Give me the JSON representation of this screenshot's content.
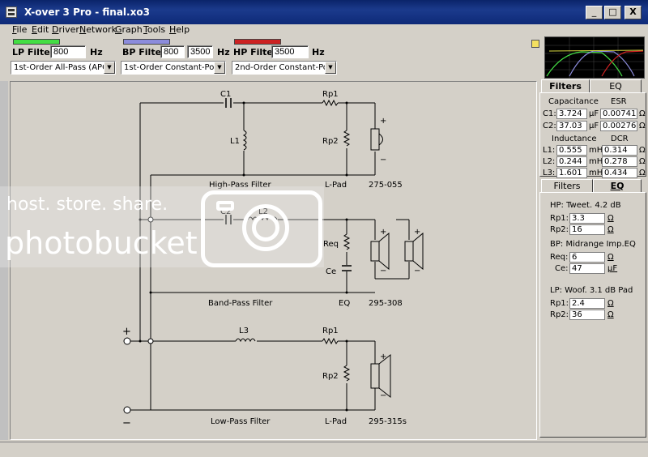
{
  "window": {
    "title": "X-over 3 Pro - final.xo3",
    "minimize": "_",
    "maximize": "□",
    "close": "X"
  },
  "menu": [
    {
      "label": "File",
      "u": "F",
      "rest": "ile"
    },
    {
      "label": "Edit",
      "u": "E",
      "rest": "dit"
    },
    {
      "label": "Driver",
      "u": "D",
      "rest": "river"
    },
    {
      "label": "Network",
      "u": "N",
      "rest": "etwork"
    },
    {
      "label": "Graph",
      "u": "G",
      "rest": "raph"
    },
    {
      "label": "Tools",
      "u": "T",
      "rest": "ools"
    },
    {
      "label": "Help",
      "u": "H",
      "rest": "elp"
    }
  ],
  "toolbar": {
    "lp": {
      "label": "LP Filter:",
      "value": "800",
      "unit": "Hz",
      "color": "#44dd44",
      "type": "1st-Order All-Pass (APC)"
    },
    "bp": {
      "label": "BP Filter:",
      "value_low": "800",
      "value_high": "3500",
      "unit": "Hz",
      "color": "#8c8cdc",
      "type": "1st-Order Constant-Power"
    },
    "hp": {
      "label": "HP Filter:",
      "value": "3500",
      "unit": "Hz",
      "color": "#cc2222",
      "type": "2nd-Order Constant-Power"
    }
  },
  "schematic": {
    "hp": {
      "c1": "C1",
      "l1": "L1",
      "rp1": "Rp1",
      "rp2": "Rp2",
      "section": "High-Pass Filter",
      "lpad": "L-Pad",
      "driver": "275-055"
    },
    "bp": {
      "c2": "C2",
      "l2": "L2",
      "req": "Req",
      "ce": "Ce",
      "section": "Band-Pass Filter",
      "eq": "EQ",
      "driver": "295-308"
    },
    "lp": {
      "l3": "L3",
      "rp1": "Rp1",
      "rp2": "Rp2",
      "section": "Low-Pass Filter",
      "lpad": "L-Pad",
      "driver": "295-315s"
    },
    "plus": "+",
    "minus": "−"
  },
  "panel": {
    "tabs_top": [
      "Filters",
      "EQ"
    ],
    "capacitance": "Capacitance",
    "esr": "ESR",
    "c1": {
      "label": "C1:",
      "value": "3.724",
      "unit": "µF",
      "esr": "0.00741",
      "ohm": "Ω"
    },
    "c2": {
      "label": "C2:",
      "value": "37.03",
      "unit": "µF",
      "esr": "0.00276",
      "ohm": "Ω"
    },
    "inductance": "Inductance",
    "dcr": "DCR",
    "l1": {
      "label": "L1:",
      "value": "0.555",
      "unit": "mH",
      "dcr": "0.314",
      "ohm": "Ω"
    },
    "l2": {
      "label": "L2:",
      "value": "0.244",
      "unit": "mH",
      "dcr": "0.278",
      "ohm": "Ω"
    },
    "l3": {
      "label": "L3:",
      "value": "1.601",
      "unit": "mH",
      "dcr": "0.434",
      "ohm": "Ω"
    },
    "tabs_bottom": [
      "Filters",
      "EQ"
    ],
    "hp_title": "HP: Tweet. 4.2 dB",
    "hp_rp1": {
      "label": "Rp1:",
      "value": "3.3",
      "unit": "Ω"
    },
    "hp_rp2": {
      "label": "Rp2:",
      "value": "16",
      "unit": "Ω"
    },
    "bp_title": "BP: Midrange Imp.EQ",
    "bp_req": {
      "label": "Req:",
      "value": "6",
      "unit": "Ω"
    },
    "bp_ce": {
      "label": "Ce:",
      "value": "47",
      "unit": "µF"
    },
    "lp_title": "LP: Woof. 3.1 dB Pad",
    "lp_rp1": {
      "label": "Rp1:",
      "value": "2.4",
      "unit": "Ω"
    },
    "lp_rp2": {
      "label": "Rp2:",
      "value": "36",
      "unit": "Ω"
    }
  },
  "watermark": {
    "line1": "host. store. share.",
    "line2": "photobucket"
  }
}
